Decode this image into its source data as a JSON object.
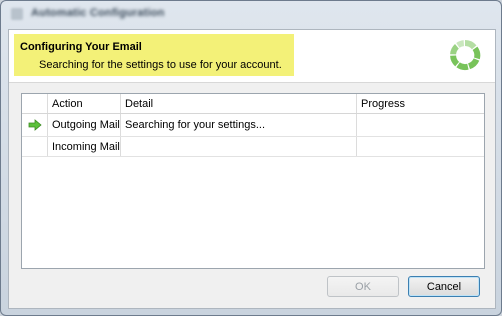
{
  "window": {
    "title": "Automatic Configuration"
  },
  "header": {
    "title": "Configuring Your Email",
    "subtitle": "Searching for the settings to use for your account.",
    "highlight_color": "#f3f178"
  },
  "spinner": {
    "icon": "progress-ring-icon",
    "color": "#78c35a"
  },
  "table": {
    "columns": [
      "",
      "Action",
      "Detail",
      "Progress"
    ],
    "rows": [
      {
        "status_icon": "green-arrow-icon",
        "action": "Outgoing Mail",
        "detail": "Searching for your settings...",
        "progress": ""
      },
      {
        "status_icon": "",
        "action": "Incoming Mail",
        "detail": "",
        "progress": ""
      }
    ]
  },
  "buttons": {
    "ok": {
      "label": "OK",
      "enabled": false
    },
    "cancel": {
      "label": "Cancel",
      "enabled": true
    }
  }
}
